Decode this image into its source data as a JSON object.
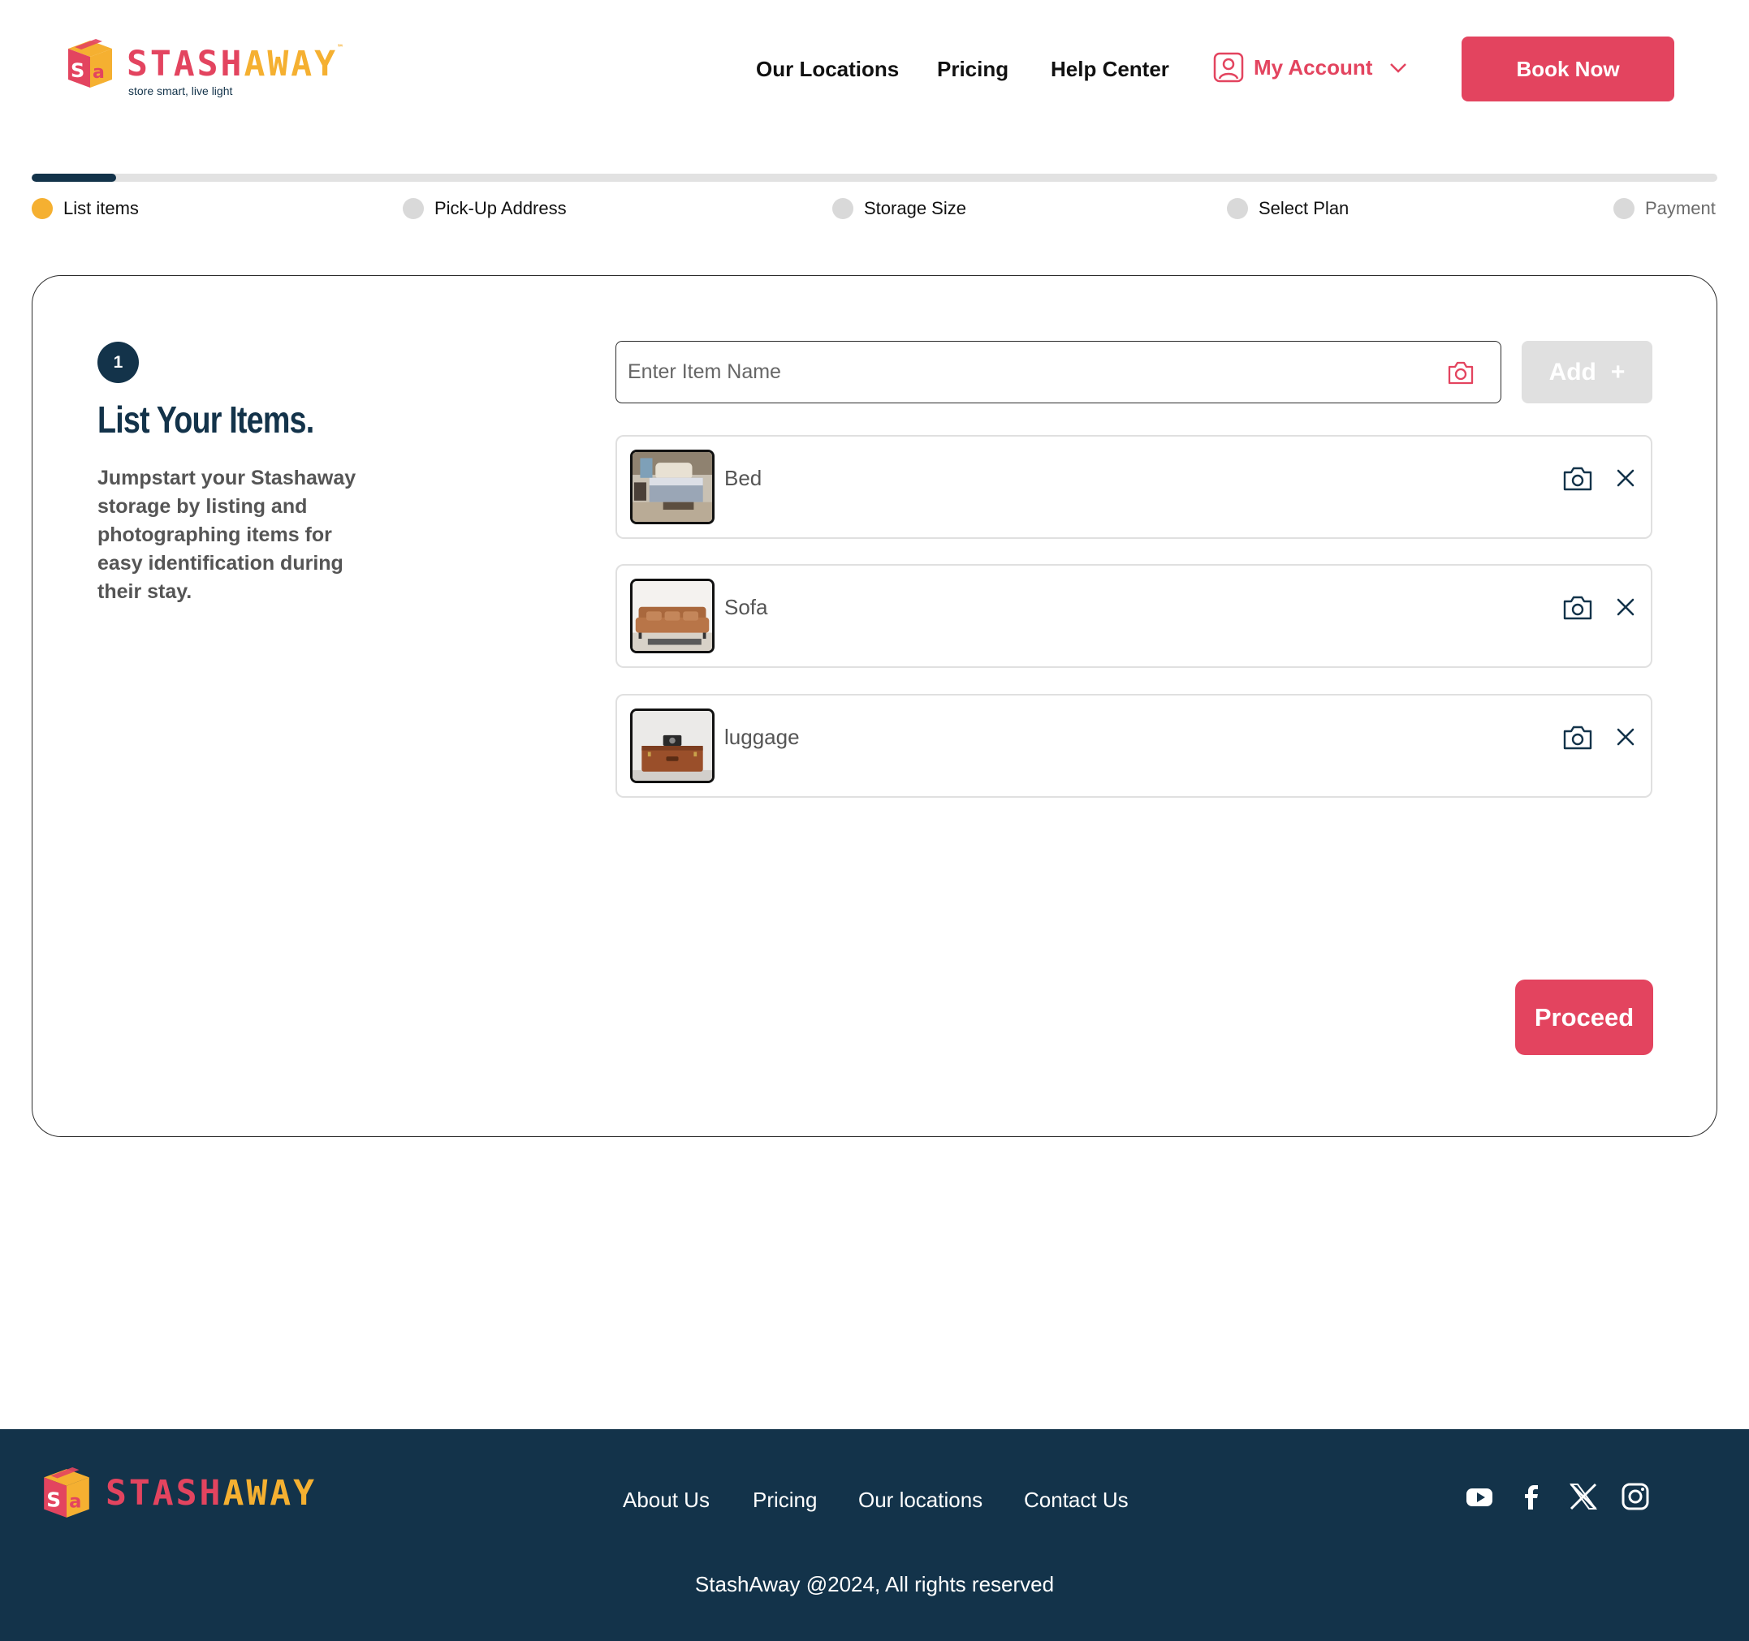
{
  "brand": {
    "name_part1": "STASH",
    "name_part2": "AWAY",
    "tagline": "store smart, live light",
    "primary_color": "#e3445f",
    "secondary_color": "#f5b031",
    "dark_color": "#13334a"
  },
  "nav": {
    "items": [
      {
        "label": "Our Locations"
      },
      {
        "label": "Pricing"
      },
      {
        "label": "Help Center"
      }
    ],
    "account_label": "My Account",
    "account_icon": "user-icon",
    "book_label": "Book Now"
  },
  "stepper": {
    "progress": 0.05,
    "steps": [
      {
        "label": "List items",
        "state": "active"
      },
      {
        "label": "Pick-Up Address",
        "state": "inactive"
      },
      {
        "label": "Storage Size",
        "state": "inactive"
      },
      {
        "label": "Select Plan",
        "state": "inactive"
      },
      {
        "label": "Payment",
        "state": "inactive"
      }
    ]
  },
  "card": {
    "step_number": "1",
    "title": "List Your Items.",
    "description": "Jumpstart your Stashaway storage by listing and photographing items for easy identification during their stay.",
    "input_placeholder": "Enter Item Name",
    "input_value": "",
    "add_label": "Add",
    "add_symbol": "+",
    "items": [
      {
        "name": "Bed",
        "thumbnail": "bed-photo"
      },
      {
        "name": "Sofa",
        "thumbnail": "sofa-photo"
      },
      {
        "name": "luggage",
        "thumbnail": "luggage-photo"
      }
    ],
    "proceed_label": "Proceed"
  },
  "footer": {
    "links": [
      {
        "label": "About Us"
      },
      {
        "label": "Pricing"
      },
      {
        "label": "Our locations"
      },
      {
        "label": "Contact Us"
      }
    ],
    "social": [
      "youtube-icon",
      "facebook-icon",
      "x-icon",
      "instagram-icon"
    ],
    "copyright": "StashAway @2024, All rights reserved"
  }
}
